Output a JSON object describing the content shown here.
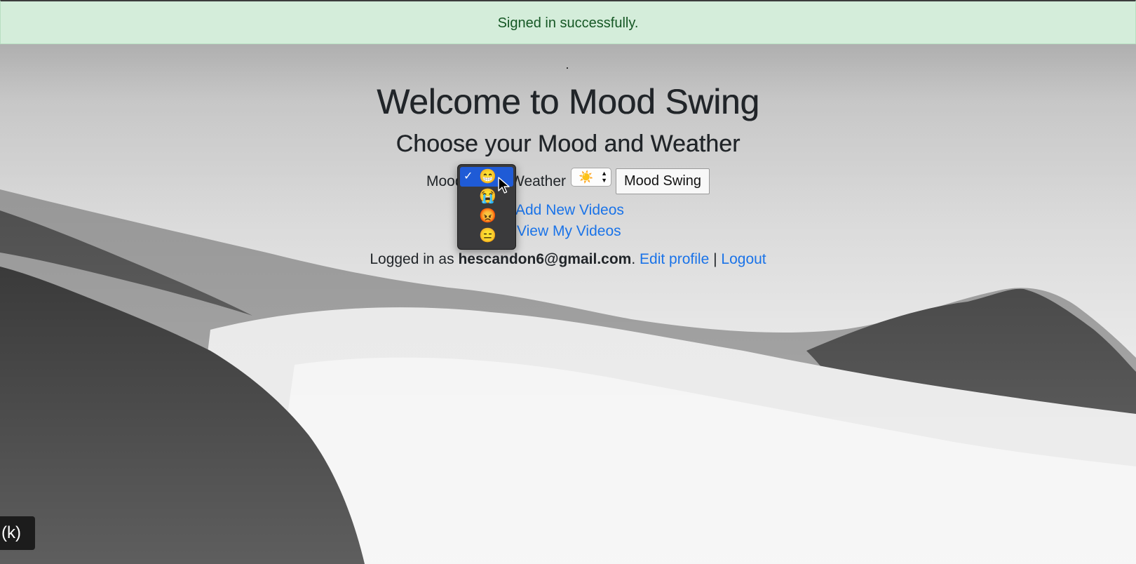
{
  "flash": {
    "message": "Signed in successfully."
  },
  "header": {
    "title": "Welcome to Mood Swing",
    "subtitle": "Choose your Mood and Weather"
  },
  "form": {
    "mood_label": "Mood",
    "weather_label": "Weather",
    "weather_selected": "☀️",
    "submit_label": "Mood Swing"
  },
  "mood_dropdown": {
    "options": [
      {
        "emoji": "😁",
        "selected": true,
        "check": "✓"
      },
      {
        "emoji": "😭",
        "selected": false
      },
      {
        "emoji": "😡",
        "selected": false
      },
      {
        "emoji": "😑",
        "selected": false
      }
    ]
  },
  "links": {
    "add_videos": "Add New Videos",
    "view_videos": "View My Videos"
  },
  "session": {
    "prefix": "Logged in as",
    "email": "hescandon6@gmail.com",
    "period": ".",
    "edit_profile": "Edit profile",
    "separator": "|",
    "logout": "Logout"
  },
  "overlay": {
    "badge": "(k)"
  }
}
